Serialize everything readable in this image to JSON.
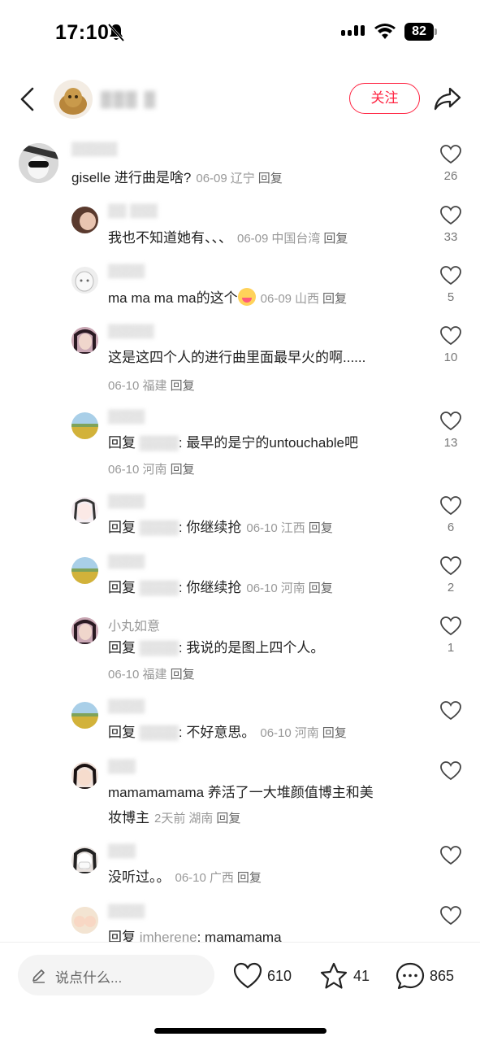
{
  "status_bar": {
    "time": "17:10",
    "battery": "82"
  },
  "header": {
    "follow_label": "关注",
    "username": "▒▒▒ ▒"
  },
  "comments": [
    {
      "username": "▒▒▒▒▒",
      "text": "giselle 进行曲是啥?",
      "date": "06-09",
      "location": "辽宁",
      "reply": "回复",
      "likes": "26"
    },
    {
      "username": "▒▒ ▒▒▒",
      "text": "我也不知道她有、、、",
      "date": "06-09",
      "location": "中国台湾",
      "reply": "回复",
      "likes": "33"
    },
    {
      "username": "▒▒▒▒",
      "text": "ma ma ma ma的这个",
      "date": "06-09",
      "location": "山西",
      "reply": "回复",
      "likes": "5"
    },
    {
      "username": "▒▒▒▒▒",
      "text": "这是这四个人的进行曲里面最早火的啊......",
      "date": "06-10",
      "location": "福建",
      "reply": "回复",
      "likes": "10"
    },
    {
      "username": "▒▒▒▒",
      "prefix": "回复",
      "masked": "▒▒▒▒",
      "text": ": 最早的是宁的untouchable吧",
      "date": "06-10",
      "location": "河南",
      "reply": "回复",
      "likes": "13"
    },
    {
      "username": "▒▒▒▒",
      "prefix": "回复",
      "masked": "▒▒▒▒",
      "text": ": 你继续抢",
      "date": "06-10",
      "location": "江西",
      "reply": "回复",
      "likes": "6"
    },
    {
      "username": "▒▒▒▒",
      "prefix": "回复",
      "masked": "▒▒▒▒",
      "text": ": 你继续抢",
      "date": "06-10",
      "location": "河南",
      "reply": "回复",
      "likes": "2"
    },
    {
      "username": "小丸如意",
      "prefix": "回复",
      "masked": "▒▒▒▒",
      "text": ": 我说的是图上四个人。",
      "date": "06-10",
      "location": "福建",
      "reply": "回复",
      "likes": "1"
    },
    {
      "username": "▒▒▒▒",
      "prefix": "回复",
      "masked": "▒▒▒▒",
      "text": ": 不好意思。",
      "date": "06-10",
      "location": "河南",
      "reply": "回复",
      "likes": ""
    },
    {
      "username": "▒▒▒",
      "text": "mamamamama 养活了一大堆颜值博主和美",
      "text2": "妆博主",
      "date": "2天前",
      "location": "湖南",
      "reply": "回复",
      "likes": ""
    },
    {
      "username": "▒▒▒",
      "text": "没听过。。",
      "date": "06-10",
      "location": "广西",
      "reply": "回复",
      "likes": ""
    },
    {
      "username": "▒▒▒▒",
      "prefix": "回复",
      "masked": "imherene",
      "text": ": mamamama",
      "likes": ""
    }
  ],
  "bottom_bar": {
    "placeholder": "说点什么...",
    "likes": "610",
    "stars": "41",
    "comments": "865"
  }
}
